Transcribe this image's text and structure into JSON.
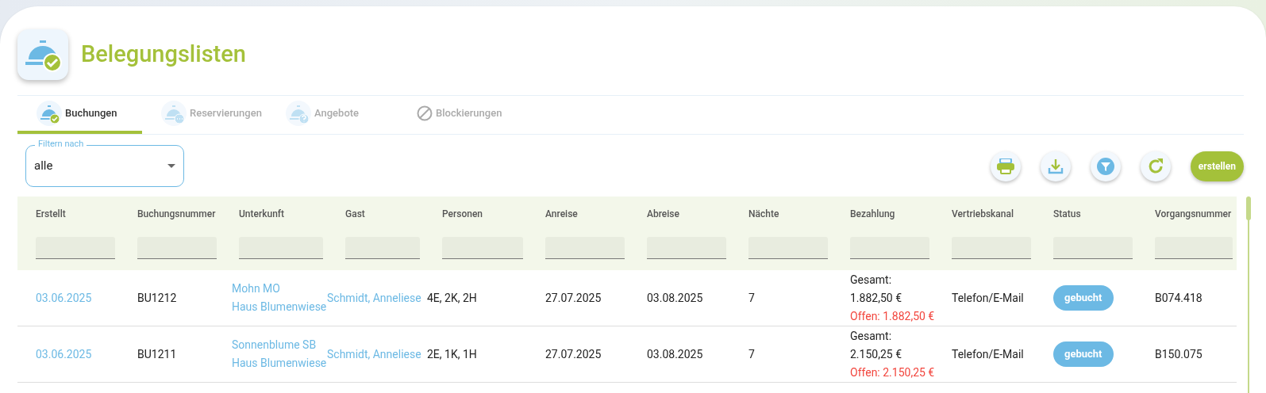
{
  "header": {
    "title": "Belegungslisten"
  },
  "tabs": [
    {
      "label": "Buchungen",
      "selected": true
    },
    {
      "label": "Reservierungen",
      "selected": false
    },
    {
      "label": "Angebote",
      "selected": false
    },
    {
      "label": "Blockierungen",
      "selected": false
    }
  ],
  "filter": {
    "label": "Filtern nach",
    "value": "alle"
  },
  "toolbar": {
    "create_button": "erstellen"
  },
  "table": {
    "columns": [
      "Erstellt",
      "Buchungsnummer",
      "Unterkunft",
      "Gast",
      "Personen",
      "Anreise",
      "Abreise",
      "Nächte",
      "Bezahlung",
      "Vertriebskanal",
      "Status",
      "Vorgangsnummer"
    ],
    "rows": [
      {
        "erstellt": "03.06.2025",
        "buchungsnummer": "BU1212",
        "unterkunft": [
          "Mohn MO",
          "Haus Blumenwiese"
        ],
        "gast": "Schmidt, Anneliese",
        "personen": "4E, 2K, 2H",
        "anreise": "27.07.2025",
        "abreise": "03.08.2025",
        "naechte": "7",
        "bezahlung": {
          "gesamt_label": "Gesamt:",
          "gesamt": "1.882,50 €",
          "offen": "Offen: 1.882,50 €"
        },
        "vertriebskanal": "Telefon/E-Mail",
        "status": "gebucht",
        "vorgangsnummer": "B074.418"
      },
      {
        "erstellt": "03.06.2025",
        "buchungsnummer": "BU1211",
        "unterkunft": [
          "Sonnenblume SB",
          "Haus Blumenwiese"
        ],
        "gast": "Schmidt, Anneliese",
        "personen": "2E, 1K, 1H",
        "anreise": "27.07.2025",
        "abreise": "03.08.2025",
        "naechte": "7",
        "bezahlung": {
          "gesamt_label": "Gesamt:",
          "gesamt": "2.150,25 €",
          "offen": "Offen: 2.150,25 €"
        },
        "vertriebskanal": "Telefon/E-Mail",
        "status": "gebucht",
        "vorgangsnummer": "B150.075"
      }
    ]
  }
}
